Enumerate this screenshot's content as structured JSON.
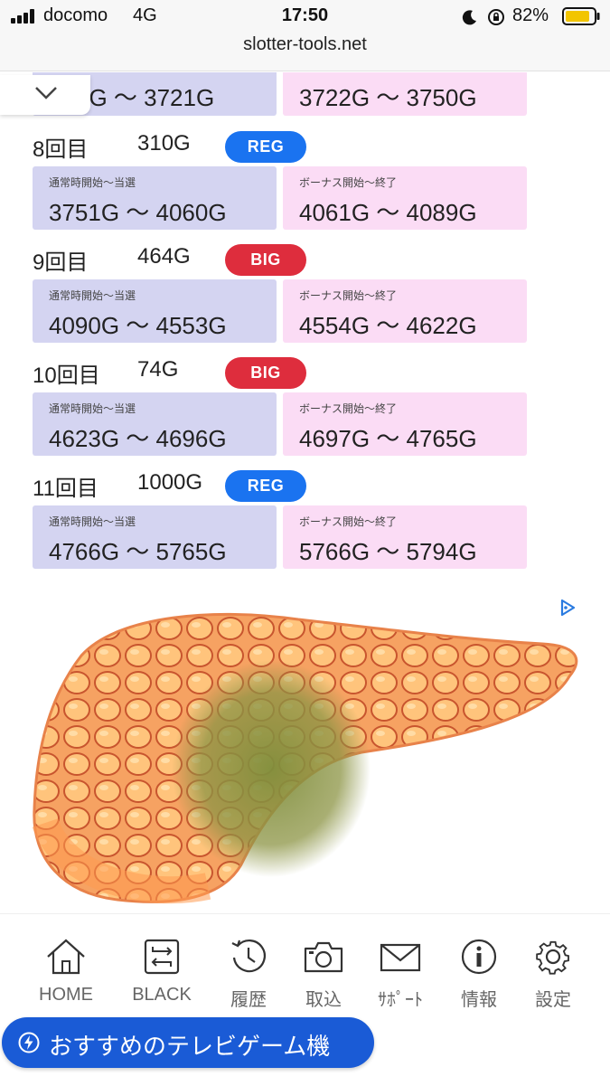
{
  "status_bar": {
    "carrier": "docomo",
    "network": "4G",
    "time": "17:50",
    "battery_percent": "82%",
    "url": "slotter-tools.net"
  },
  "partial_row": {
    "left_value": "3431G 〜 3721G",
    "left_visible": "1G 〜 3721G",
    "right_value": "3722G 〜 3750G"
  },
  "labels": {
    "normal_caption": "通常時開始〜当選",
    "bonus_caption": "ボーナス開始〜終了"
  },
  "history": [
    {
      "count": "8回目",
      "games": "310G",
      "type": "REG",
      "normal": "3751G 〜 4060G",
      "bonus": "4061G 〜 4089G"
    },
    {
      "count": "9回目",
      "games": "464G",
      "type": "BIG",
      "normal": "4090G 〜 4553G",
      "bonus": "4554G 〜 4622G"
    },
    {
      "count": "10回目",
      "games": "74G",
      "type": "BIG",
      "normal": "4623G 〜 4696G",
      "bonus": "4697G 〜 4765G"
    },
    {
      "count": "11回目",
      "games": "1000G",
      "type": "REG",
      "normal": "4766G 〜 5765G",
      "bonus": "5766G 〜 5794G"
    }
  ],
  "nav": [
    {
      "label": "HOME",
      "icon": "home-icon"
    },
    {
      "label": "BLACK",
      "icon": "swap-icon"
    },
    {
      "label": "履歴",
      "icon": "history-icon"
    },
    {
      "label": "取込",
      "icon": "camera-icon"
    },
    {
      "label": "ｻﾎﾟｰﾄ",
      "icon": "mail-icon"
    },
    {
      "label": "情報",
      "icon": "info-icon"
    },
    {
      "label": "設定",
      "icon": "gear-icon"
    }
  ],
  "recommend_button": "おすすめのテレビゲーム機",
  "colors": {
    "reg": "#1a73f0",
    "big": "#de2d3d",
    "normal_box": "#d4d4f1",
    "bonus_box": "#fbdcf5",
    "recommend": "#1a5bd6"
  }
}
